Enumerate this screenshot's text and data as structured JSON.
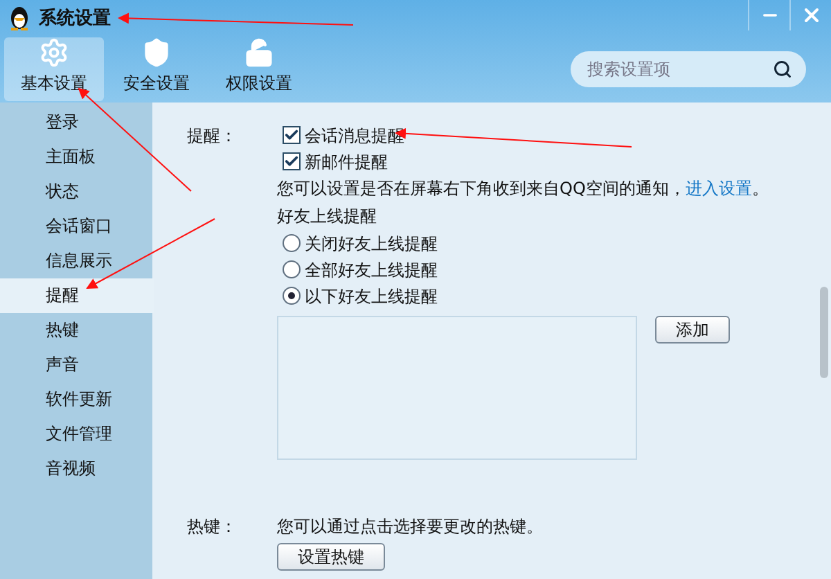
{
  "window": {
    "title": "系统设置"
  },
  "toolbar": {
    "tabs": [
      {
        "label": "基本设置",
        "selected": true
      },
      {
        "label": "安全设置",
        "selected": false
      },
      {
        "label": "权限设置",
        "selected": false
      }
    ],
    "search": {
      "placeholder": "搜索设置项"
    }
  },
  "sidebar": {
    "items": [
      {
        "label": "登录",
        "selected": false
      },
      {
        "label": "主面板",
        "selected": false
      },
      {
        "label": "状态",
        "selected": false
      },
      {
        "label": "会话窗口",
        "selected": false
      },
      {
        "label": "信息展示",
        "selected": false
      },
      {
        "label": "提醒",
        "selected": true
      },
      {
        "label": "热键",
        "selected": false
      },
      {
        "label": "声音",
        "selected": false
      },
      {
        "label": "软件更新",
        "selected": false
      },
      {
        "label": "文件管理",
        "selected": false
      },
      {
        "label": "音视频",
        "selected": false
      }
    ]
  },
  "reminder": {
    "label": "提醒：",
    "checkboxes": [
      {
        "label": "会话消息提醒",
        "checked": true
      },
      {
        "label": "新邮件提醒",
        "checked": true
      }
    ],
    "note": {
      "text": "您可以设置是否在屏幕右下角收到来自QQ空间的通知，",
      "link": "进入设置",
      "end": "。"
    },
    "friend_title": "好友上线提醒",
    "radios": [
      {
        "label": "关闭好友上线提醒",
        "selected": false
      },
      {
        "label": "全部好友上线提醒",
        "selected": false
      },
      {
        "label": "以下好友上线提醒",
        "selected": true
      }
    ],
    "add_button": "添加"
  },
  "hotkey": {
    "label": "热键：",
    "text": "您可以通过点击选择要更改的热键。",
    "button": "设置热键"
  }
}
